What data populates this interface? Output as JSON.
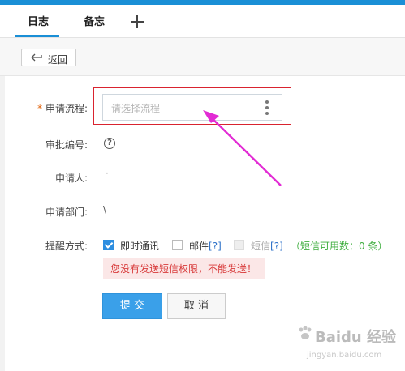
{
  "tabs": [
    {
      "label": "日志"
    },
    {
      "label": "备忘"
    }
  ],
  "toolbar": {
    "back_label": "返回"
  },
  "form": {
    "process": {
      "label": "申请流程:",
      "placeholder": "请选择流程"
    },
    "approval_no": {
      "label": "审批编号:",
      "help": "?"
    },
    "applicant": {
      "label": "申请人:",
      "value": "·"
    },
    "department": {
      "label": "申请部门:",
      "value": "\\ "
    },
    "remind": {
      "label": "提醒方式:",
      "im": {
        "label": "即时通讯",
        "checked": true
      },
      "mail": {
        "label": "邮件",
        "link": "[?]"
      },
      "sms": {
        "label": "短信",
        "link": "[?]"
      },
      "sms_count": "（短信可用数：0 条）",
      "warning": "您没有发送短信权限，不能发送！"
    }
  },
  "actions": {
    "submit": "提 交",
    "cancel": "取 消"
  },
  "watermark": {
    "text": "Baidu 经验",
    "url": "jingyan.baidu.com"
  },
  "colors": {
    "accent": "#1a8fd6",
    "annotation": "#e22bd4",
    "highlight": "#d9232f"
  }
}
